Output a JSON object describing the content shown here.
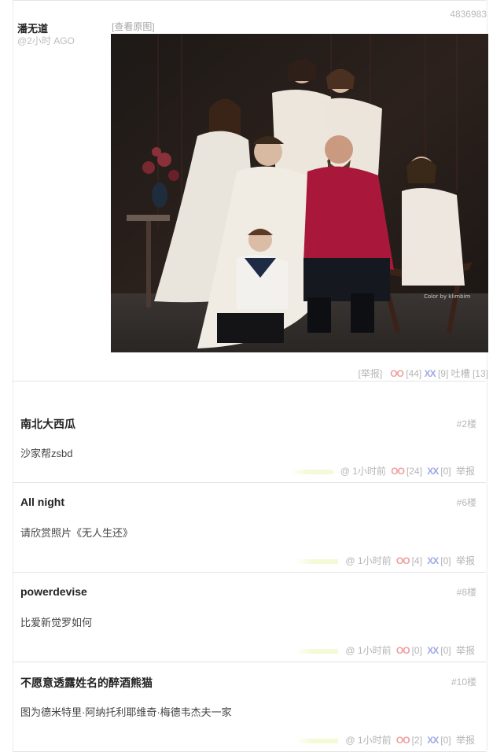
{
  "post": {
    "id": "4836983",
    "author": "潘无道",
    "time": "@2小时 AGO",
    "view_original": "[查看原图]",
    "image_credit": "Color by klimbim",
    "actions": {
      "report": "[举报]",
      "oo_label": "OO",
      "oo_count": "[44]",
      "xx_label": "XX",
      "xx_count": "[9]",
      "tucao": "吐槽 [13]"
    }
  },
  "comments": [
    {
      "author": "南北大西瓜",
      "floor": "#2楼",
      "text": "沙家帮zsbd",
      "time": "@ 1小时前",
      "oo_label": "OO",
      "oo": "[24]",
      "xx_label": "XX",
      "xx": "[0]",
      "report": "举报"
    },
    {
      "author": "All night",
      "floor": "#6楼",
      "text": "请欣赏照片《无人生还》",
      "time": "@ 1小时前",
      "oo_label": "OO",
      "oo": "[4]",
      "xx_label": "XX",
      "xx": "[0]",
      "report": "举报"
    },
    {
      "author": "powerdevise",
      "floor": "#8楼",
      "text": "比爱新觉罗如何",
      "time": "@ 1小时前",
      "oo_label": "OO",
      "oo": "[0]",
      "xx_label": "XX",
      "xx": "[0]",
      "report": "举报"
    },
    {
      "author": "不愿意透露姓名的醉酒熊猫",
      "floor": "#10楼",
      "text": "图为德米特里·阿纳托利耶维奇·梅德韦杰夫一家",
      "time": "@ 1小时前",
      "oo_label": "OO",
      "oo": "[2]",
      "xx_label": "XX",
      "xx": "[0]",
      "report": "举报"
    }
  ],
  "colors": {
    "oo": "#f0a0a0",
    "xx": "#9fa9e8",
    "muted": "#b5b5b5"
  }
}
